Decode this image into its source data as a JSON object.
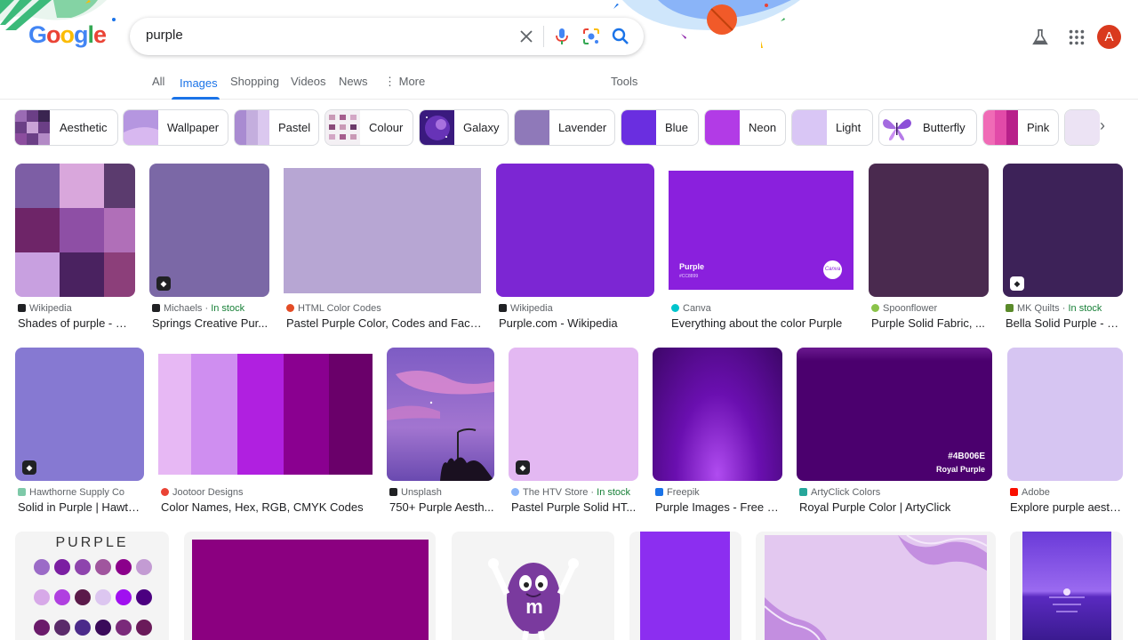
{
  "search": {
    "query": "purple"
  },
  "logo": {
    "letters": [
      "G",
      "o",
      "o",
      "g",
      "l",
      "e"
    ]
  },
  "header": {
    "avatar_letter": "A"
  },
  "tabs": [
    {
      "label": "All"
    },
    {
      "label": "Images"
    },
    {
      "label": "Shopping"
    },
    {
      "label": "Videos"
    },
    {
      "label": "News"
    },
    {
      "label": "⋮ More"
    },
    {
      "label": "Tools"
    }
  ],
  "chips": [
    {
      "label": "Aesthetic",
      "color": "#6b3f86"
    },
    {
      "label": "Wallpaper",
      "color": "#b596e0"
    },
    {
      "label": "Pastel",
      "color": "#c4aede"
    },
    {
      "label": "Colour",
      "color": "#c999b6"
    },
    {
      "label": "Galaxy",
      "color": "#5b2a9e"
    },
    {
      "label": "Lavender",
      "color": "#8f79b9"
    },
    {
      "label": "Blue",
      "color": "#6a2ee0"
    },
    {
      "label": "Neon",
      "color": "#b23be6"
    },
    {
      "label": "Light",
      "color": "#d9c6f5"
    },
    {
      "label": "Butterfly",
      "color": "#ffffff"
    },
    {
      "label": "Pink",
      "color": "#e45fb8"
    },
    {
      "label": "",
      "color": "#ece3f4"
    }
  ],
  "results_row1": [
    {
      "source": "Wikipedia",
      "title": "Shades of purple - Wi...",
      "stock": "",
      "color": "#7a5aa8"
    },
    {
      "source": "Michaels",
      "title": "Springs Creative Pur...",
      "stock": "In stock",
      "color": "#7b68a6"
    },
    {
      "source": "HTML Color Codes",
      "title": "Pastel Purple Color, Codes and Facts ...",
      "stock": "",
      "color": "#b7a6d3"
    },
    {
      "source": "Wikipedia",
      "title": "Purple.com - Wikipedia",
      "stock": "",
      "color": "#7c26d3"
    },
    {
      "source": "Canva",
      "title": "Everything about the color Purple",
      "stock": "",
      "color": "#8a20dd"
    },
    {
      "source": "Spoonflower",
      "title": "Purple Solid Fabric, ...",
      "stock": "",
      "color": "#4a2a4f"
    },
    {
      "source": "MK Quilts",
      "title": "Bella Solid Purple - M...",
      "stock": "In stock",
      "color": "#3d2258"
    }
  ],
  "results_row2": [
    {
      "source": "Hawthorne Supply Co",
      "title": "Solid in Purple | Hawth...",
      "stock": "",
      "color": "#8679d2"
    },
    {
      "source": "Jootoor Designs",
      "title": "Color Names, Hex, RGB, CMYK Codes",
      "stock": "",
      "color": "#b33ee0"
    },
    {
      "source": "Unsplash",
      "title": "750+ Purple Aesth...",
      "stock": "",
      "color": "#8b66c5"
    },
    {
      "source": "The HTV Store",
      "title": "Pastel Purple Solid HT...",
      "stock": "In stock",
      "color": "#e3b8f2"
    },
    {
      "source": "Freepik",
      "title": "Purple Images - Free D...",
      "stock": "",
      "color": "#6a0fb0"
    },
    {
      "source": "ArtyClick Colors",
      "title": "Royal Purple Color | ArtyClick",
      "stock": "",
      "color": "#4b006e"
    },
    {
      "source": "Adobe",
      "title": "Explore purple aesth...",
      "stock": "",
      "color": "#d6c5f2"
    }
  ],
  "canva_thumb": {
    "name": "Purple",
    "hex": "#CC8899",
    "brand": "Canva"
  },
  "artyclick_thumb": {
    "hex": "#4B006E",
    "name": "Royal Purple"
  },
  "purple_chart": {
    "title": "PURPLE"
  },
  "mm_thumb": {
    "letter": "m"
  }
}
